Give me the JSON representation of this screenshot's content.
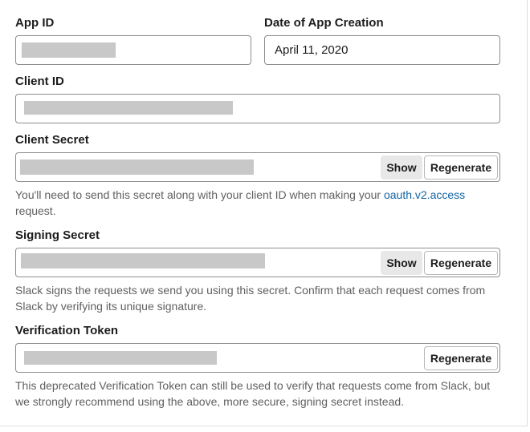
{
  "app_id": {
    "label": "App ID",
    "value_masked": true
  },
  "creation_date": {
    "label": "Date of App Creation",
    "value": "April 11, 2020"
  },
  "client_id": {
    "label": "Client ID",
    "value_masked": true
  },
  "client_secret": {
    "label": "Client Secret",
    "value_masked": true,
    "show_label": "Show",
    "regenerate_label": "Regenerate",
    "help_before": "You'll need to send this secret along with your client ID when making your",
    "help_link": "oauth.v2.access",
    "help_after": "request."
  },
  "signing_secret": {
    "label": "Signing Secret",
    "value_masked": true,
    "show_label": "Show",
    "regenerate_label": "Regenerate",
    "help": "Slack signs the requests we send you using this secret. Confirm that each request comes from Slack by verifying its unique signature."
  },
  "verification_token": {
    "label": "Verification Token",
    "value_masked": true,
    "regenerate_label": "Regenerate",
    "help": "This deprecated Verification Token can still be used to verify that requests come from Slack, but we strongly recommend using the above, more secure, signing secret instead."
  },
  "colors": {
    "link": "#1264a3",
    "help_text": "#616061",
    "mask": "#c8c8c8",
    "show_button_bg": "#e8e8e8"
  }
}
